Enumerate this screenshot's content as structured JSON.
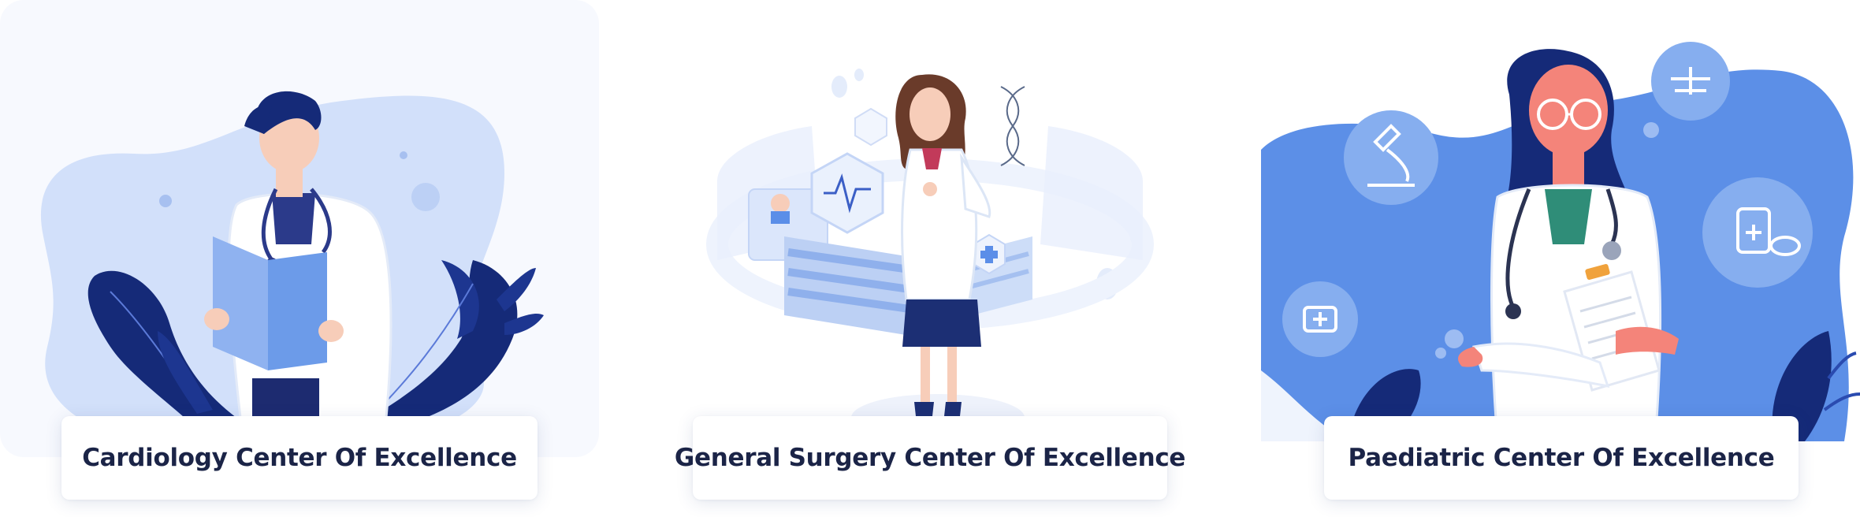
{
  "cards": [
    {
      "title": "Cardiology Center Of Excellence",
      "illustration": "cardiology-doctor-illustration"
    },
    {
      "title": "General Surgery Center Of Excellence",
      "illustration": "surgery-doctor-illustration"
    },
    {
      "title": "Paediatric Center Of Excellence",
      "illustration": "paediatric-doctor-illustration"
    }
  ],
  "colors": {
    "heading": "#1b2447",
    "accent_blue": "#5b8ee8",
    "light_blue": "#d3e0fa",
    "navy": "#152a78"
  }
}
